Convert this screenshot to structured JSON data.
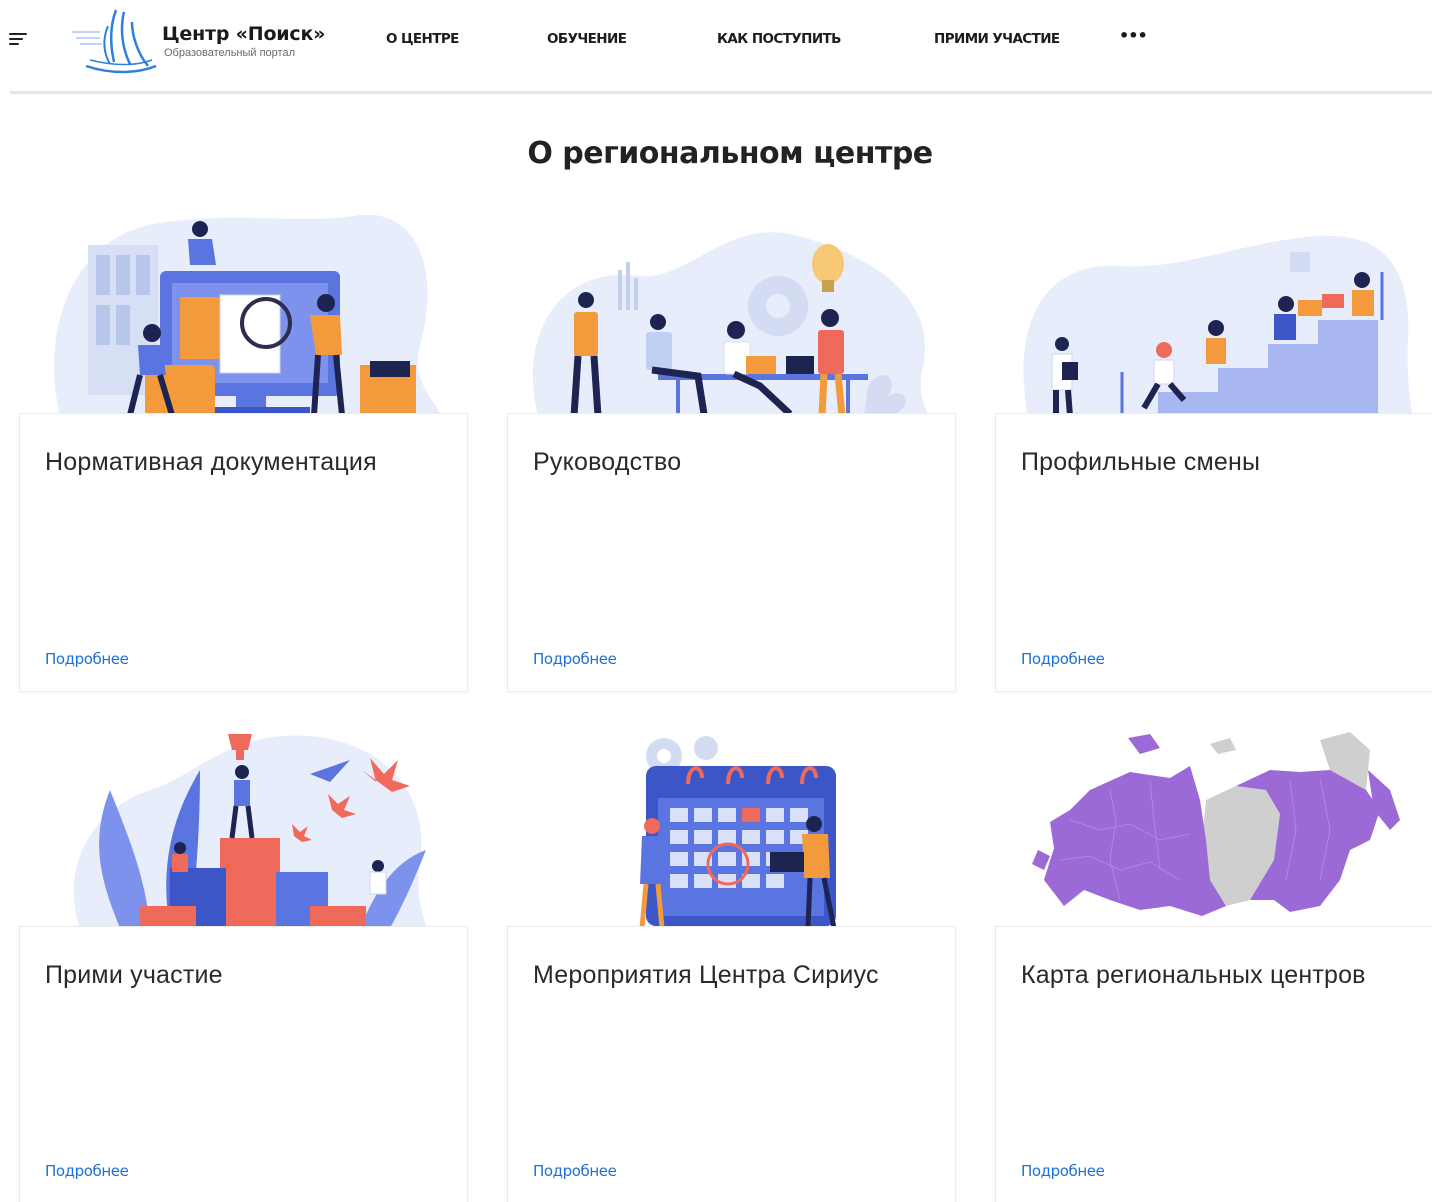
{
  "header": {
    "logo_title": "Центр «Поиск»",
    "logo_subtitle": "Образовательный портал",
    "nav": [
      {
        "label": "О ЦЕНТРЕ"
      },
      {
        "label": "ОБУЧЕНИЕ"
      },
      {
        "label": "КАК ПОСТУПИТЬ"
      },
      {
        "label": "ПРИМИ УЧАСТИЕ"
      }
    ],
    "more_label": "•••"
  },
  "main": {
    "title": "О региональном центре",
    "cards": [
      {
        "title": "Нормативная документация",
        "link": "Подробнее",
        "illustration": "office-documents-illustration"
      },
      {
        "title": "Руководство",
        "link": "Подробнее",
        "illustration": "team-meeting-illustration"
      },
      {
        "title": "Профильные смены",
        "link": "Подробнее",
        "illustration": "students-stairs-illustration"
      },
      {
        "title": "Прими участие",
        "link": "Подробнее",
        "illustration": "podium-trophy-illustration"
      },
      {
        "title": "Мероприятия Центра Сириус",
        "link": "Подробнее",
        "illustration": "calendar-illustration"
      },
      {
        "title": "Карта региональных центров",
        "link": "Подробнее",
        "illustration": "russia-map-illustration"
      }
    ]
  },
  "colors": {
    "accent_link": "#1f6fd6",
    "illus_blue": "#5a74e0",
    "illus_light": "#e7edfb",
    "illus_orange": "#f29a3c",
    "illus_red": "#ef6a5b",
    "map_purple": "#9b6ad6",
    "map_grey": "#cfcfcf"
  }
}
